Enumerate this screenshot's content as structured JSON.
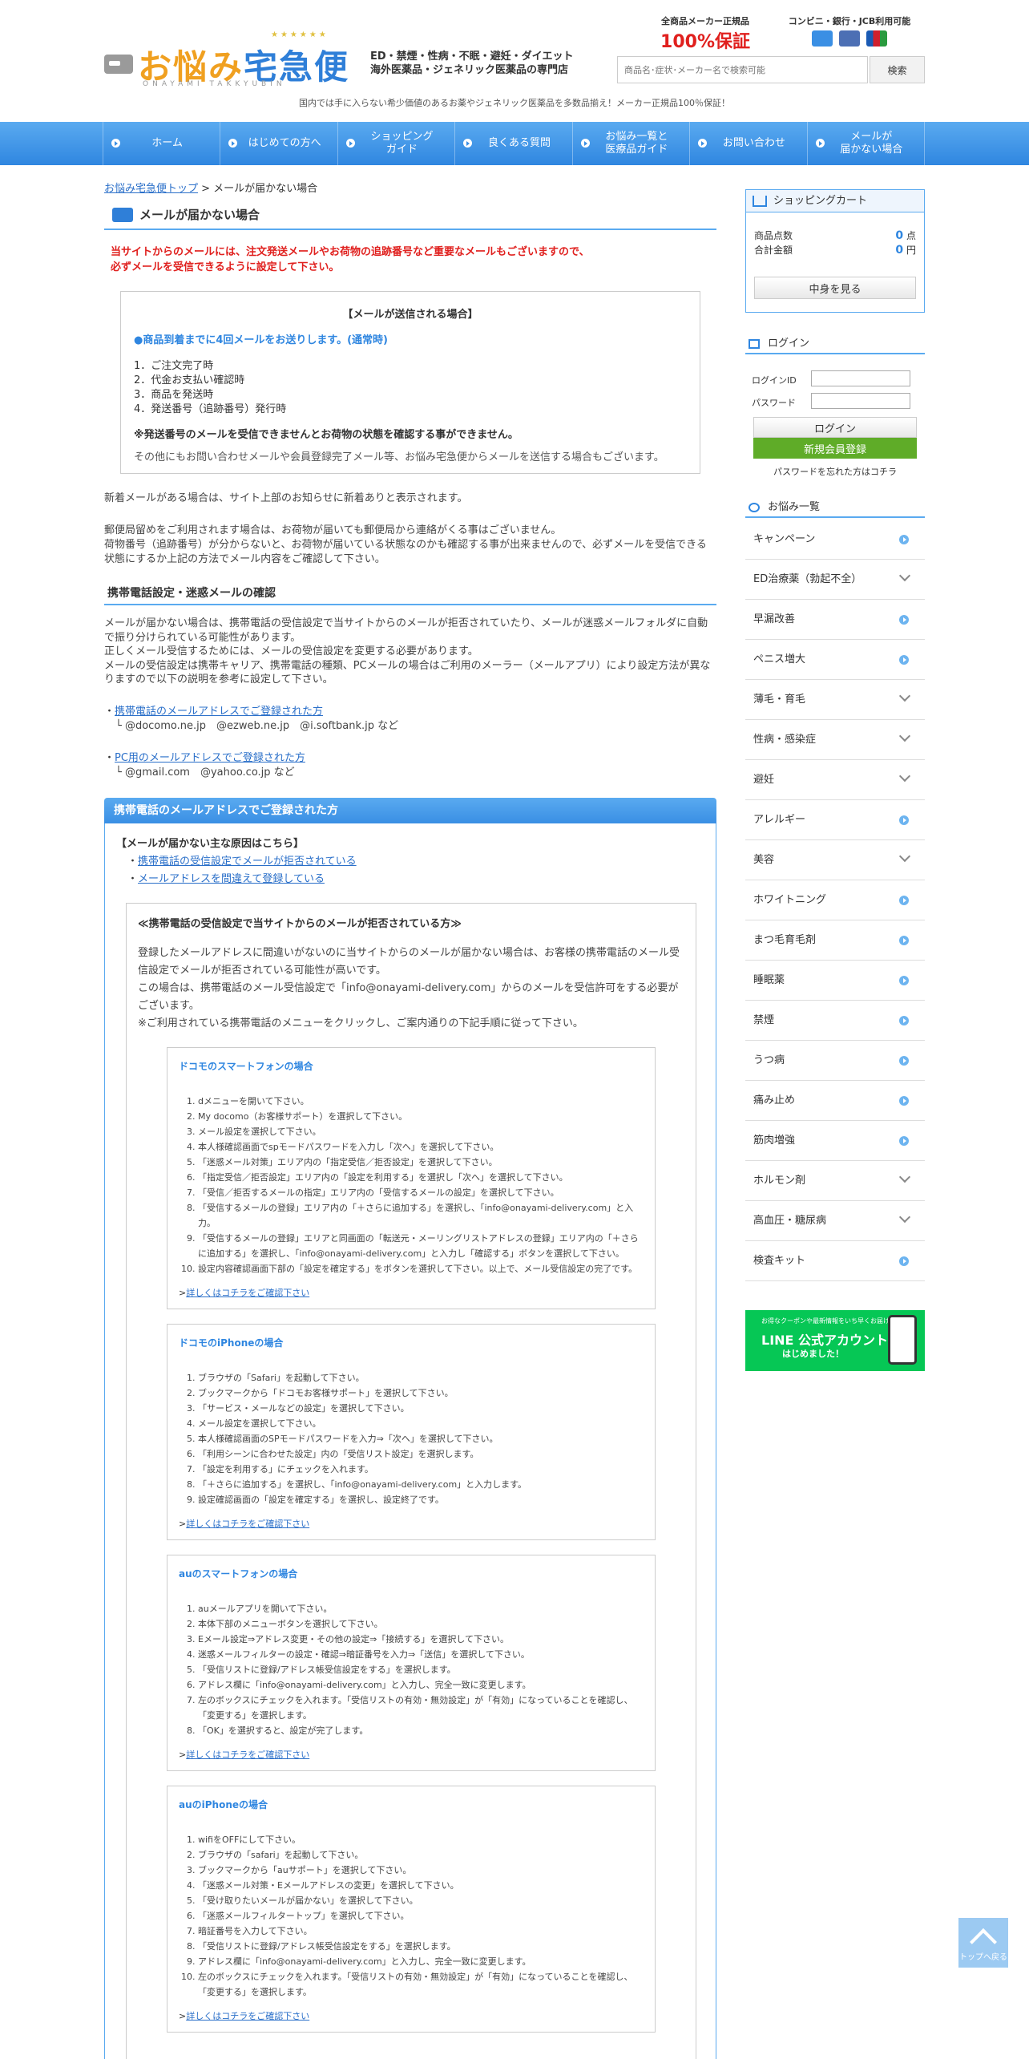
{
  "header": {
    "logo_text_a": "お悩み",
    "logo_text_b": "宅急便",
    "logo_sub": "ONAYAMI TAKKYUBIN",
    "catch1": "ED・禁煙・性病・不眠・避妊・ダイエット",
    "catch2": "海外医薬品・ジェネリック医薬品の専門店",
    "badge1_title": "全商品メーカー正規品",
    "badge1_main": "100%保証",
    "badge2_title": "コンビニ・銀行・JCB利用可能",
    "search_placeholder": "商品名･症状･メーカー名で検索可能",
    "search_button": "検索",
    "notice": "国内では手に入らない希少価値のあるお薬やジェネリック医薬品を多数品揃え！メーカー正規品100％保証！"
  },
  "nav": [
    "ホーム",
    "はじめての方へ",
    "ショッピング\nガイド",
    "良くある質問",
    "お悩み一覧と\n医療品ガイド",
    "お問い合わせ",
    "メールが\n届かない場合"
  ],
  "main": {
    "crumb_link": "お悩み宅急便トップ",
    "crumb_current": " > メールが届かない場合",
    "title": "メールが届かない場合",
    "warn1": "当サイトからのメールには、注文発送メールやお荷物の追跡番号など重要なメールもございますので、",
    "warn2": "必ずメールを受信できるように設定して下さい。",
    "box_title": "【メールが送信される場合】",
    "box_blue": "●商品到着までに4回メールをお送りします。(通常時)",
    "box_items": [
      "1．ご注文完了時",
      "2．代金お支払い確認時",
      "3．商品を発送時",
      "4．発送番号（追跡番号）発行時"
    ],
    "box_strong": "※発送番号のメールを受信できませんとお荷物の状態を確認する事ができません。",
    "box_p": "その他にもお問い合わせメールや会員登録完了メール等、お悩み宅急便からメールを送信する場合もございます。",
    "par1": "新着メールがある場合は、サイト上部のお知らせに新着ありと表示されます。",
    "par2a": "郵便局留めをご利用されます場合は、お荷物が届いても郵便局から連絡がくる事はございません。",
    "par2b": "荷物番号（追跡番号）が分からないと、お荷物が届いている状態なのかも確認する事が出来ませんので、必ずメールを受信できる状態にするか上記の方法でメール内容をご確認して下さい。",
    "h2": "携帯電話設定・迷惑メールの確認",
    "par3a": "メールが届かない場合は、携帯電話の受信設定で当サイトからのメールが拒否されていたり、メールが迷惑メールフォルダに自動で振り分けられている可能性があります。",
    "par3b": "正しくメール受信するためには、メールの受信設定を変更する必要があります。",
    "par3c": "メールの受信設定は携帯キャリア、携帯電話の種類、PCメールの場合はご利用のメーラー（メールアプリ）により設定方法が異なりますので以下の説明を参考に設定して下さい。",
    "link1": "携帯電話のメールアドレスでご登録された方",
    "link1_sub": "└ @docomo.ne.jp　@ezweb.ne.jp　@i.softbank.jp など",
    "link2": "PC用のメールアドレスでご登録された方",
    "link2_sub": "└ @gmail.com　@yahoo.co.jp など",
    "bar_title": "携帯電話のメールアドレスでご登録された方",
    "cause_title": "【メールが届かない主な原因はこちら】",
    "cause1": "携帯電話の受信設定でメールが拒否されている",
    "cause2": "メールアドレスを間違えて登録している",
    "inner_title": "≪携帯電話の受信設定で当サイトからのメールが拒否されている方≫",
    "inner_txt1": "登録したメールアドレスに間違いがないのに当サイトからのメールが届かない場合は、お客様の携帯電話のメール受信設定でメールが拒否されている可能性が高いです。",
    "inner_txt2": "この場合は、携帯電話のメール受信設定で「info@onayami-delivery.com」からのメールを受信許可をする必要がございます。",
    "inner_txt3": "※ご利用されている携帯電話のメニューをクリックし、ご案内通りの下記手順に従って下さい。",
    "more": "詳しくはコチラをご確認下さい",
    "carriers": [
      {
        "title": "ドコモのスマートフォンの場合",
        "steps": [
          "dメニューを開いて下さい。",
          "My docomo（お客様サポート）を選択して下さい。",
          "メール設定を選択して下さい。",
          "本人様確認画面でspモードパスワードを入力し「次へ」を選択して下さい。",
          "「迷惑メール対策」エリア内の「指定受信／拒否設定」を選択して下さい。",
          "「指定受信／拒否設定」エリア内の「設定を利用する」を選択し「次へ」を選択して下さい。",
          "「受信／拒否するメールの指定」エリア内の「受信するメールの設定」を選択して下さい。",
          "「受信するメールの登録」エリア内の「＋さらに追加する」を選択し、「info@onayami-delivery.com」と入力。",
          "「受信するメールの登録」エリアと同画面の「転送元・メーリングリストアドレスの登録」エリア内の「＋さらに追加する」を選択し、「info@onayami-delivery.com」と入力し「確認する」ボタンを選択して下さい。",
          "設定内容確認画面下部の「設定を確定する」をボタンを選択して下さい。以上で、メール受信設定の完了です。"
        ]
      },
      {
        "title": "ドコモのiPhoneの場合",
        "steps": [
          "ブラウザの「Safari」を起動して下さい。",
          "ブックマークから「ドコモお客様サポート」を選択して下さい。",
          "「サービス・メールなどの設定」を選択して下さい。",
          "メール設定を選択して下さい。",
          "本人様確認画面のSPモードパスワードを入力⇒「次へ」を選択して下さい。",
          "「利用シーンに合わせた設定」内の「受信リスト設定」を選択します。",
          "「設定を利用する」にチェックを入れます。",
          "「＋さらに追加する」を選択し、「info@onayami-delivery.com」と入力します。",
          "設定確認画面の「設定を確定する」を選択し、設定終了です。"
        ]
      },
      {
        "title": "auのスマートフォンの場合",
        "steps": [
          "auメールアプリを開いて下さい。",
          "本体下部のメニューボタンを選択して下さい。",
          "Eメール設定⇒アドレス変更・その他の設定⇒「接続する」を選択して下さい。",
          "迷惑メールフィルターの設定・確認⇒暗証番号を入力⇒「送信」を選択して下さい。",
          "「受信リストに登録/アドレス帳受信設定をする」を選択します。",
          "アドレス欄に「info@onayami-delivery.com」と入力し、完全一致に変更します。",
          "左のボックスにチェックを入れます。「受信リストの有効・無効設定」が「有効」になっていることを確認し、「変更する」を選択します。",
          "「OK」を選択すると、設定が完了します。"
        ]
      },
      {
        "title": "auのiPhoneの場合",
        "steps": [
          "wifiをOFFにして下さい。",
          "ブラウザの「safari」を起動して下さい。",
          "ブックマークから「auサポート」を選択して下さい。",
          "「迷惑メール対策・Eメールアドレスの変更」を選択して下さい。",
          "「受け取りたいメールが届かない」を選択して下さい。",
          "「迷惑メールフィルタートップ」を選択して下さい。",
          "暗証番号を入力して下さい。",
          "「受信リストに登録/アドレス帳受信設定をする」を選択します。",
          "アドレス欄に「info@onayami-delivery.com」と入力し、完全一致に変更します。",
          "左のボックスにチェックを入れます。「受信リストの有効・無効設定」が「有効」になっていることを確認し、「変更する」を選択します。"
        ]
      }
    ]
  },
  "sidebar": {
    "cart_title": "ショッピングカート",
    "cart_count_label": "商品点数",
    "cart_count": "0",
    "cart_count_unit": " 点",
    "cart_total_label": "合計金額",
    "cart_total": "0",
    "cart_total_unit": " 円",
    "cart_button": "中身を見る",
    "login_title": "ログイン",
    "login_id": "ログインID",
    "login_pw": "パスワード",
    "login_button": "ログイン",
    "register_button": "新規会員登録",
    "forgot": "パスワードを忘れた方はコチラ",
    "cat_title": "お悩み一覧",
    "cats": [
      {
        "label": "キャンペーン",
        "kind": "arrow"
      },
      {
        "label": "ED治療薬（勃起不全）",
        "kind": "down"
      },
      {
        "label": "早漏改善",
        "kind": "arrow"
      },
      {
        "label": "ペニス増大",
        "kind": "arrow"
      },
      {
        "label": "薄毛・育毛",
        "kind": "down"
      },
      {
        "label": "性病・感染症",
        "kind": "down"
      },
      {
        "label": "避妊",
        "kind": "down"
      },
      {
        "label": "アレルギー",
        "kind": "arrow"
      },
      {
        "label": "美容",
        "kind": "down"
      },
      {
        "label": "ホワイトニング",
        "kind": "arrow"
      },
      {
        "label": "まつ毛育毛剤",
        "kind": "arrow"
      },
      {
        "label": "睡眠薬",
        "kind": "arrow"
      },
      {
        "label": "禁煙",
        "kind": "arrow"
      },
      {
        "label": "うつ病",
        "kind": "arrow"
      },
      {
        "label": "痛み止め",
        "kind": "arrow"
      },
      {
        "label": "筋肉増強",
        "kind": "arrow"
      },
      {
        "label": "ホルモン剤",
        "kind": "down"
      },
      {
        "label": "高血圧・糖尿病",
        "kind": "down"
      },
      {
        "label": "検査キット",
        "kind": "arrow"
      }
    ],
    "line_small": "お得なクーポンや最新情報をいち早くお届け！",
    "line_main": "LINE 公式アカウント",
    "line_sub": "はじめました！"
  },
  "totop": "トップへ戻る",
  "colors": {
    "accent": "#3a8fe4",
    "warn": "#e0201e",
    "line": "#06c755"
  }
}
